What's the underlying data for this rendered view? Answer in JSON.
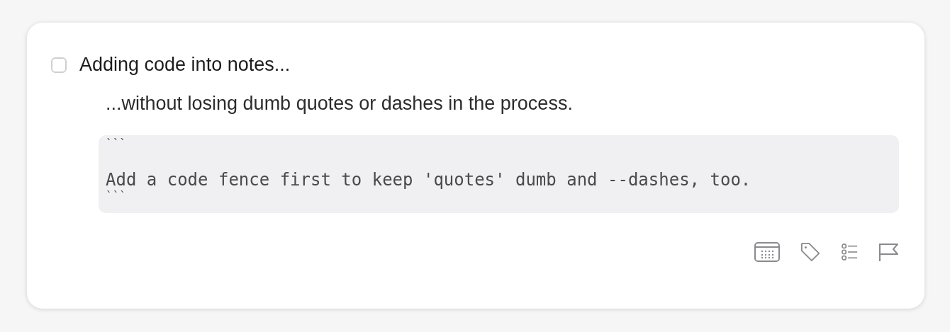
{
  "task": {
    "title": "Adding code into notes...",
    "checked": false,
    "note": "...without losing dumb quotes or dashes in the process.",
    "code_lines": [
      "```",
      "Add a code fence first to keep 'quotes' dumb and --dashes, too.",
      "```"
    ]
  }
}
